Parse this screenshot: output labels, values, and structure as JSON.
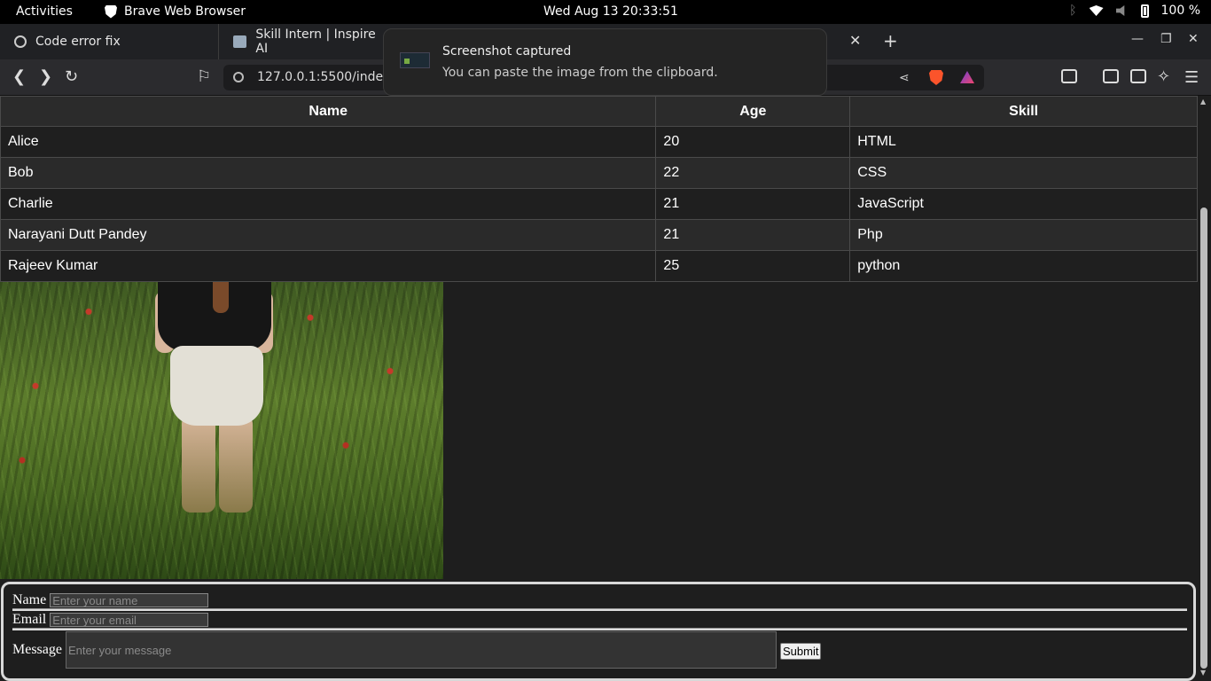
{
  "system_bar": {
    "activities": "Activities",
    "app_name": "Brave Web Browser",
    "clock": "Wed Aug 13  20:33:51",
    "battery": "100 %"
  },
  "browser": {
    "tabs": [
      {
        "title": "Code error fix",
        "icon": "openai-icon"
      },
      {
        "title": "Skill Intern | Inspire AI",
        "icon": "page-icon"
      }
    ],
    "url": "127.0.0.1:5500/index.h"
  },
  "notification": {
    "title": "Screenshot captured",
    "body": "You can paste the image from the clipboard."
  },
  "table": {
    "headers": [
      "Name",
      "Age",
      "Skill"
    ],
    "rows": [
      {
        "name": "Alice",
        "age": "20",
        "skill": "HTML"
      },
      {
        "name": "Bob",
        "age": "22",
        "skill": "CSS"
      },
      {
        "name": "Charlie",
        "age": "21",
        "skill": "JavaScript"
      },
      {
        "name": "Narayani Dutt Pandey",
        "age": "21",
        "skill": "Php"
      },
      {
        "name": "Rajeev Kumar",
        "age": "25",
        "skill": "python"
      }
    ]
  },
  "form": {
    "name_label": "Name",
    "name_placeholder": "Enter your name",
    "email_label": "Email",
    "email_placeholder": "Enter your email",
    "message_label": "Message",
    "message_placeholder": "Enter your message",
    "submit_label": "Submit"
  }
}
